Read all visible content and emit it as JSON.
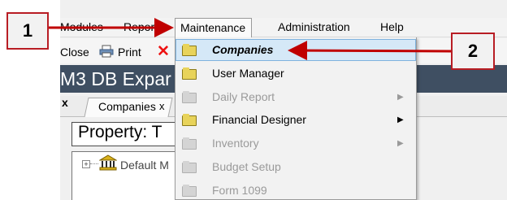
{
  "menubar": {
    "items": [
      "Modules",
      "Reports",
      "Maintenance",
      "Administration",
      "Help"
    ]
  },
  "toolbar": {
    "close_label": "Close",
    "print_label": "Print"
  },
  "window": {
    "title": "M3 DB Expar"
  },
  "tabs": {
    "active_label": "Companies"
  },
  "property": {
    "label": "Property: T"
  },
  "tree": {
    "root_label": "Default M"
  },
  "dropdown": {
    "items": [
      {
        "label": "Companies",
        "enabled": true,
        "highlighted": true,
        "submenu": false
      },
      {
        "label": "User Manager",
        "enabled": true,
        "highlighted": false,
        "submenu": false
      },
      {
        "label": "Daily Report",
        "enabled": false,
        "highlighted": false,
        "submenu": true
      },
      {
        "label": "Financial Designer",
        "enabled": true,
        "highlighted": false,
        "submenu": true
      },
      {
        "label": "Inventory",
        "enabled": false,
        "highlighted": false,
        "submenu": true
      },
      {
        "label": "Budget Setup",
        "enabled": false,
        "highlighted": false,
        "submenu": false
      },
      {
        "label": "Form 1099",
        "enabled": false,
        "highlighted": false,
        "submenu": false
      }
    ]
  },
  "callouts": {
    "step1": "1",
    "step2": "2"
  },
  "colors": {
    "callout_border": "#b81d24",
    "arrow": "#c00000",
    "highlight_bg": "#d5e8f7",
    "title_bg": "#3f4f62"
  },
  "icons": [
    "printer-icon",
    "close-x-icon",
    "folder-icon",
    "bank-icon",
    "chevron-right-icon",
    "expand-icon"
  ]
}
